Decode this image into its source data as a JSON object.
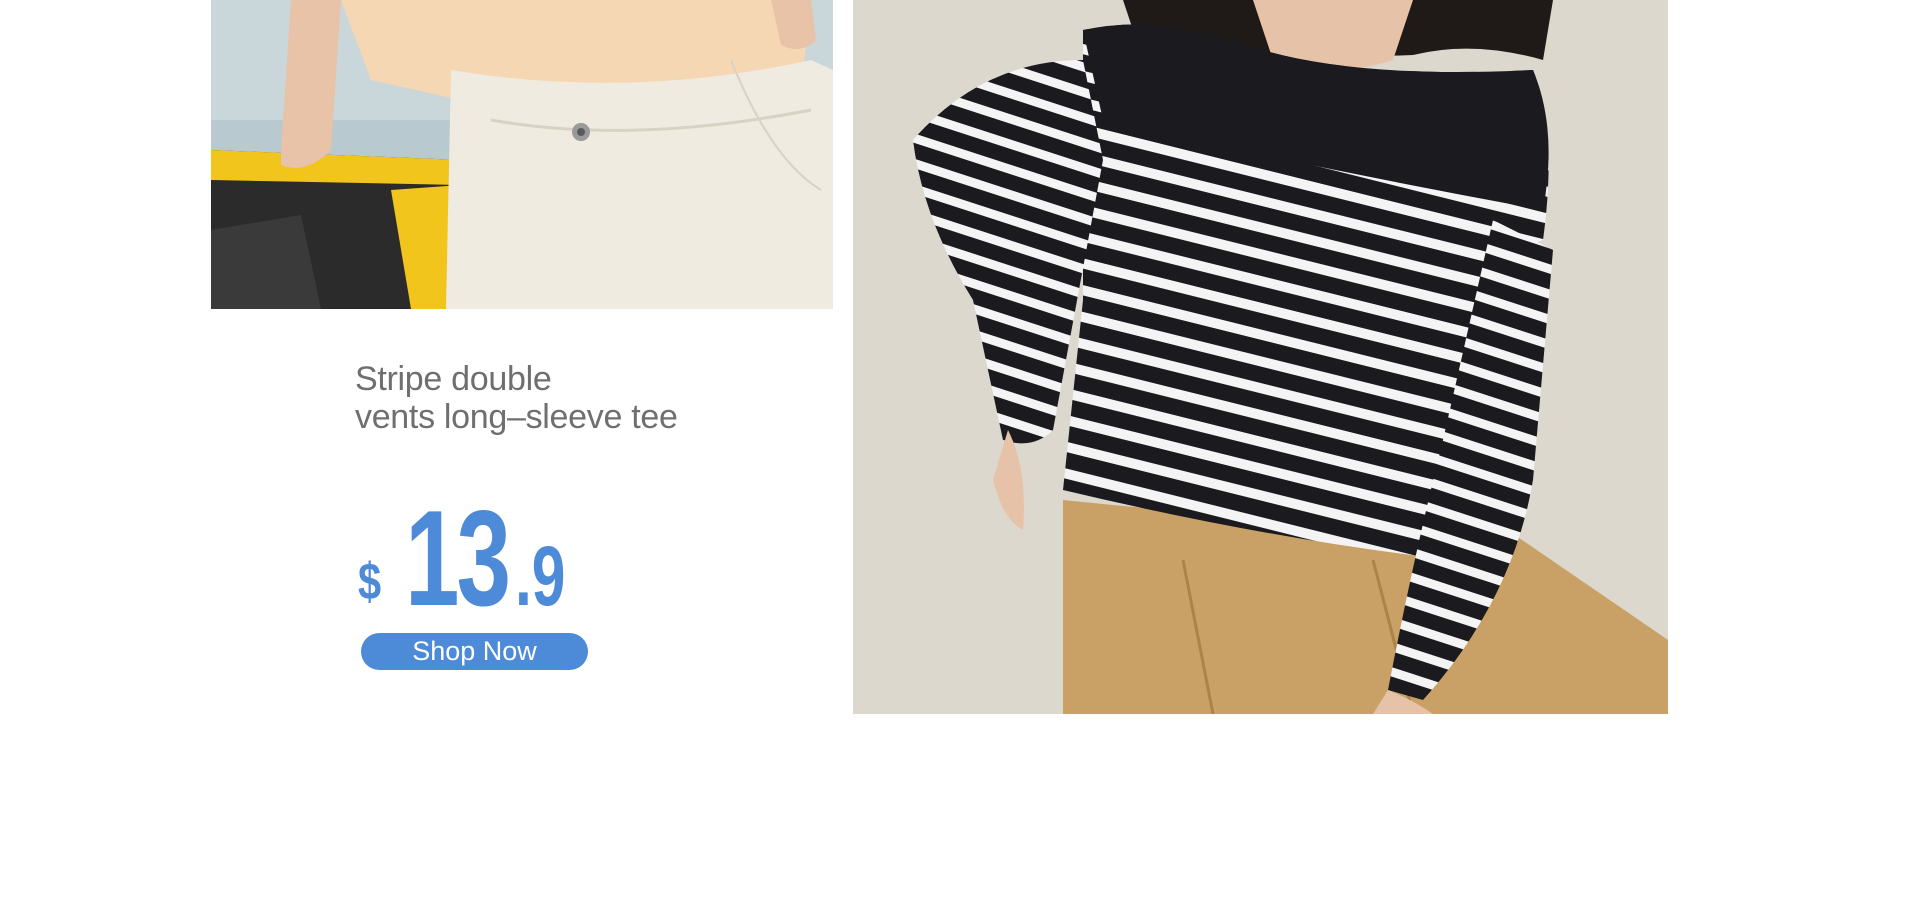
{
  "product": {
    "title_line1": "Stripe double",
    "title_line2": "vents long–sleeve tee",
    "price_currency": "$",
    "price_integer": "13",
    "price_decimal": ".9",
    "cta_label": "Shop Now"
  },
  "images": {
    "left": "model-white-jeans-photo",
    "right": "model-striped-tee-photo"
  },
  "colors": {
    "accent": "#4d8ad8",
    "title_text": "#6f6f6f",
    "background": "#ffffff"
  }
}
